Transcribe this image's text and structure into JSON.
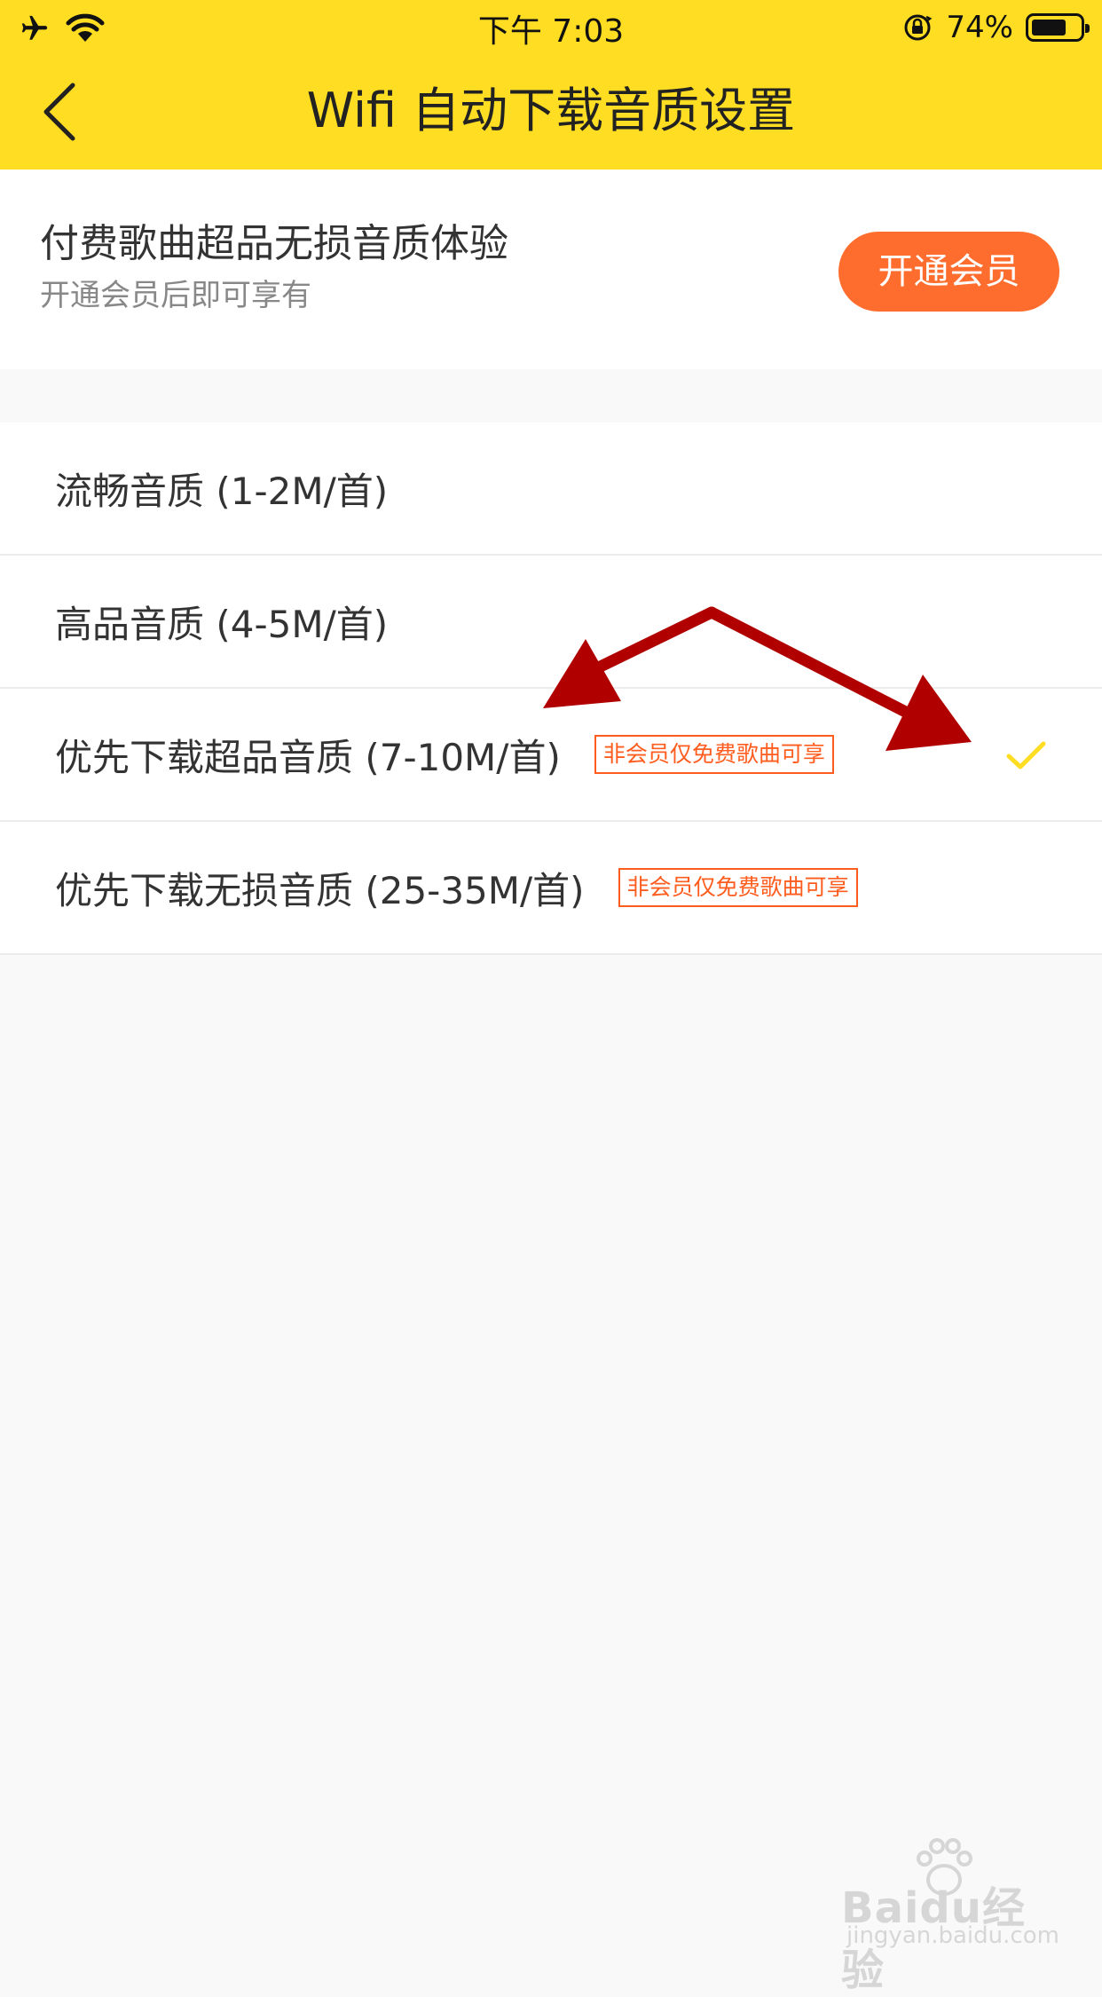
{
  "status_bar": {
    "time": "下午 7:03",
    "battery_percent": "74%",
    "battery_level": 0.74
  },
  "header": {
    "title": "Wifi 自动下载音质设置",
    "back_icon": "chevron-left-icon"
  },
  "promo": {
    "title": "付费歌曲超品无损音质体验",
    "subtitle": "开通会员后即可享有",
    "button_label": "开通会员"
  },
  "quality_options": [
    {
      "label": "流畅音质 (1-2M/首)",
      "badge": "",
      "selected": false
    },
    {
      "label": "高品音质 (4-5M/首)",
      "badge": "",
      "selected": false
    },
    {
      "label": "优先下载超品音质 (7-10M/首)",
      "badge": "非会员仅免费歌曲可享",
      "selected": true
    },
    {
      "label": "优先下载无损音质 (25-35M/首)",
      "badge": "非会员仅免费歌曲可享",
      "selected": false
    }
  ],
  "colors": {
    "header_bg": "#fedd22",
    "vip_button": "#ff6d2e",
    "badge": "#ff5d1f",
    "check": "#fedd22",
    "annotation_arrow": "#b00000"
  },
  "watermark": {
    "logo_text": "Baidu经验",
    "url_text": "jingyan.baidu.com"
  }
}
